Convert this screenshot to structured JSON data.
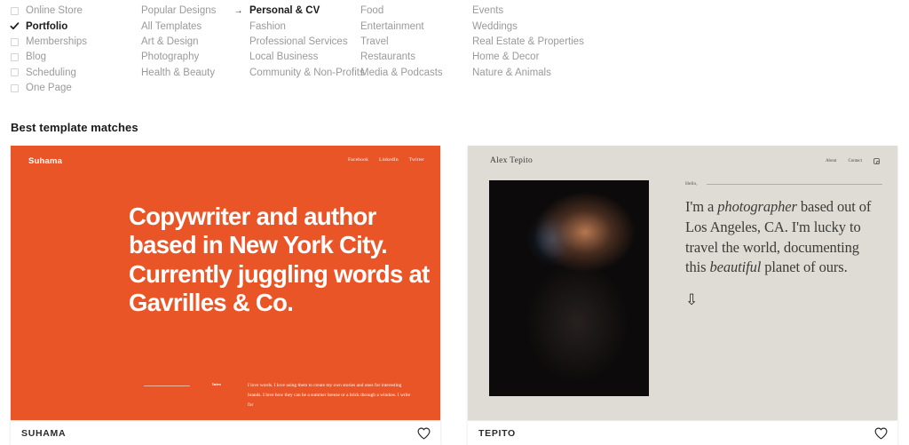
{
  "filters": {
    "columns": [
      {
        "name": "site-type",
        "items": [
          {
            "label": "Online Store",
            "marker": "checkbox",
            "checked": false,
            "active": false
          },
          {
            "label": "Portfolio",
            "marker": "checkbox",
            "checked": true,
            "active": true
          },
          {
            "label": "Memberships",
            "marker": "checkbox",
            "checked": false,
            "active": false
          },
          {
            "label": "Blog",
            "marker": "checkbox",
            "checked": false,
            "active": false
          },
          {
            "label": "Scheduling",
            "marker": "checkbox",
            "checked": false,
            "active": false
          },
          {
            "label": "One Page",
            "marker": "checkbox",
            "checked": false,
            "active": false
          }
        ]
      },
      {
        "name": "categories-1",
        "items": [
          {
            "label": "Popular Designs",
            "marker": "none",
            "checked": false,
            "active": false
          },
          {
            "label": "All Templates",
            "marker": "none",
            "checked": false,
            "active": false
          },
          {
            "label": "Art & Design",
            "marker": "none",
            "checked": false,
            "active": false
          },
          {
            "label": "Photography",
            "marker": "none",
            "checked": false,
            "active": false
          },
          {
            "label": "Health & Beauty",
            "marker": "none",
            "checked": false,
            "active": false
          }
        ]
      },
      {
        "name": "categories-2",
        "items": [
          {
            "label": "Personal & CV",
            "marker": "arrow",
            "checked": false,
            "active": true
          },
          {
            "label": "Fashion",
            "marker": "none",
            "checked": false,
            "active": false
          },
          {
            "label": "Professional Services",
            "marker": "none",
            "checked": false,
            "active": false
          },
          {
            "label": "Local Business",
            "marker": "none",
            "checked": false,
            "active": false
          },
          {
            "label": "Community & Non-Profits",
            "marker": "none",
            "checked": false,
            "active": false
          }
        ]
      },
      {
        "name": "categories-3",
        "items": [
          {
            "label": "Food",
            "marker": "none",
            "checked": false,
            "active": false
          },
          {
            "label": "Entertainment",
            "marker": "none",
            "checked": false,
            "active": false
          },
          {
            "label": "Travel",
            "marker": "none",
            "checked": false,
            "active": false
          },
          {
            "label": "Restaurants",
            "marker": "none",
            "checked": false,
            "active": false
          },
          {
            "label": "Media & Podcasts",
            "marker": "none",
            "checked": false,
            "active": false
          }
        ]
      },
      {
        "name": "categories-4",
        "items": [
          {
            "label": "Events",
            "marker": "none",
            "checked": false,
            "active": false
          },
          {
            "label": "Weddings",
            "marker": "none",
            "checked": false,
            "active": false
          },
          {
            "label": "Real Estate & Properties",
            "marker": "none",
            "checked": false,
            "active": false
          },
          {
            "label": "Home & Decor",
            "marker": "none",
            "checked": false,
            "active": false
          },
          {
            "label": "Nature & Animals",
            "marker": "none",
            "checked": false,
            "active": false
          }
        ]
      }
    ]
  },
  "results": {
    "section_title": "Best template matches",
    "cards": [
      {
        "name": "SUHAMA",
        "accent_color": "#ea5527",
        "favorite_icon": "heart-icon",
        "preview": {
          "logo": "Suhama",
          "nav": [
            "Facebook",
            "LinkedIn",
            "Twitter"
          ],
          "headline": "Copywriter and author based in New York City. Currently juggling words at Gavrilles & Co.",
          "intro_label": "Intro",
          "body": "I love words. I love using them to create my own stories and ones for interesting brands. I love how they can be a summer breeze or a brick through a window. I write for"
        }
      },
      {
        "name": "TEPITO",
        "accent_color": "#dedcd5",
        "favorite_icon": "heart-icon",
        "preview": {
          "logo": "Alex Tepito",
          "nav": [
            "About",
            "Contact"
          ],
          "social_icon": "instagram-icon",
          "greeting": "Hello,",
          "body_1": "I'm a ",
          "body_em_1": "photographer",
          "body_2": " based out of Los Angeles, CA. I'm lucky to travel the world, documenting this ",
          "body_em_2": "beautiful",
          "body_3": " planet of ours.",
          "scroll_arrow": "⇩"
        }
      }
    ]
  }
}
